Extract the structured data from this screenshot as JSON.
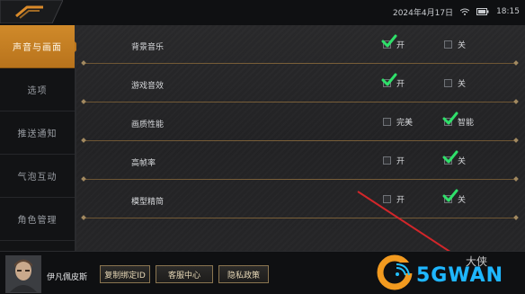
{
  "status": {
    "date": "2024年4月17日",
    "time": "18:15"
  },
  "sidebar": {
    "items": [
      {
        "label": "声音与画面",
        "active": true
      },
      {
        "label": "选项",
        "active": false
      },
      {
        "label": "推送通知",
        "active": false
      },
      {
        "label": "气泡互动",
        "active": false
      },
      {
        "label": "角色管理",
        "active": false
      }
    ]
  },
  "settings": {
    "rows": [
      {
        "label": "背景音乐",
        "options": [
          {
            "label": "开",
            "checked": true
          },
          {
            "label": "关",
            "checked": false
          }
        ]
      },
      {
        "label": "游戏音效",
        "options": [
          {
            "label": "开",
            "checked": true
          },
          {
            "label": "关",
            "checked": false
          }
        ]
      },
      {
        "label": "画质性能",
        "options": [
          {
            "label": "完美",
            "checked": false
          },
          {
            "label": "智能",
            "checked": true
          }
        ]
      },
      {
        "label": "高帧率",
        "options": [
          {
            "label": "开",
            "checked": false
          },
          {
            "label": "关",
            "checked": true
          }
        ]
      },
      {
        "label": "模型精简",
        "options": [
          {
            "label": "开",
            "checked": false
          },
          {
            "label": "关",
            "checked": true
          }
        ]
      }
    ]
  },
  "player": {
    "name": "伊凡佩皮斯"
  },
  "buttons": {
    "bind_id": "复制绑定ID",
    "service": "客服中心",
    "privacy": "隐私政策"
  },
  "watermark": {
    "brand": "5GWAN",
    "small": "大侠"
  },
  "colors": {
    "accent": "#c57f24",
    "check": "#2fe06a",
    "divider": "#8a6a3c",
    "watermark": "#1fb7ff"
  },
  "icons": {
    "back": "back-arrow-icon",
    "check": "check-icon",
    "wifi": "wifi-icon",
    "battery": "battery-icon"
  }
}
